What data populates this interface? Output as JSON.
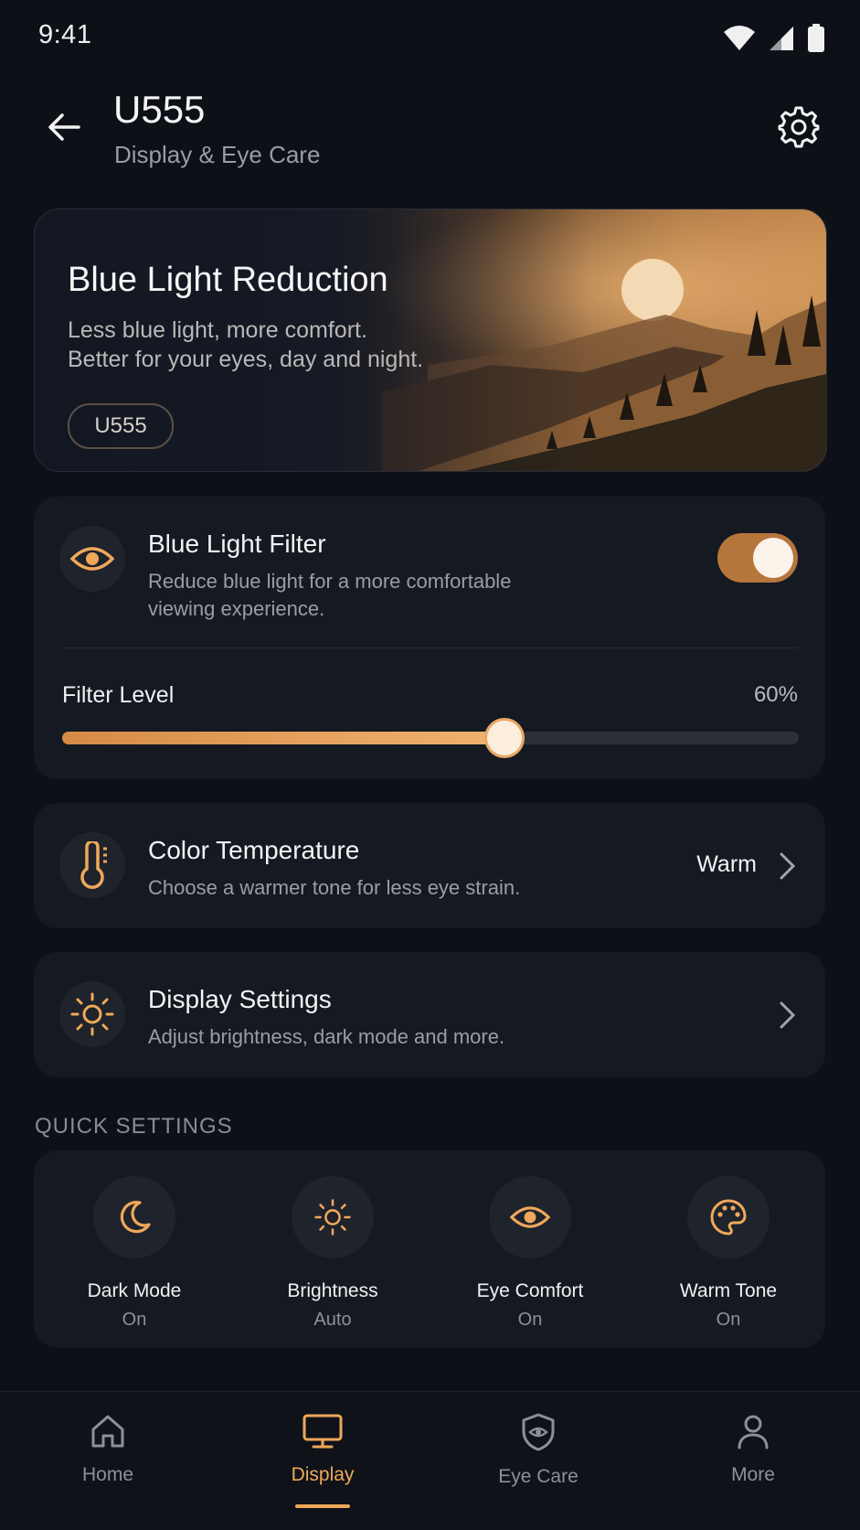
{
  "status": {
    "time": "9:41"
  },
  "header": {
    "title": "U555",
    "subtitle": "Display & Eye Care",
    "back_icon": "arrow-left-icon",
    "settings_icon": "gear-icon"
  },
  "hero": {
    "title": "Blue Light Reduction",
    "line1": "Less blue light, more comfort.",
    "line2": "Better for your eyes, day and night.",
    "chip": "U555"
  },
  "filter_card": {
    "title": "Blue Light Filter",
    "desc1": "Reduce blue light for a more comfortable",
    "desc2": "viewing experience.",
    "enabled": true,
    "level_label": "Filter Level",
    "level_value": "60%",
    "level_fraction": 0.6
  },
  "color_temp": {
    "title": "Color Temperature",
    "desc": "Choose a warmer tone for less eye strain.",
    "value": "Warm"
  },
  "display_settings": {
    "title": "Display Settings",
    "desc": "Adjust brightness, dark mode and more."
  },
  "quick_settings": {
    "label": "QUICK SETTINGS",
    "items": [
      {
        "label": "Dark Mode",
        "value": "On",
        "icon": "moon-icon"
      },
      {
        "label": "Brightness",
        "value": "Auto",
        "icon": "sun-icon"
      },
      {
        "label": "Eye Comfort",
        "value": "On",
        "icon": "eye-icon"
      },
      {
        "label": "Warm Tone",
        "value": "On",
        "icon": "palette-icon"
      }
    ]
  },
  "nav": {
    "items": [
      {
        "label": "Home",
        "icon": "home-icon"
      },
      {
        "label": "Display",
        "icon": "monitor-icon",
        "active": true
      },
      {
        "label": "Eye Care",
        "icon": "shield-eye-icon"
      },
      {
        "label": "More",
        "icon": "person-icon"
      }
    ]
  },
  "colors": {
    "accent": "#efa85a",
    "background": "#0d1017",
    "card": "#151922"
  }
}
